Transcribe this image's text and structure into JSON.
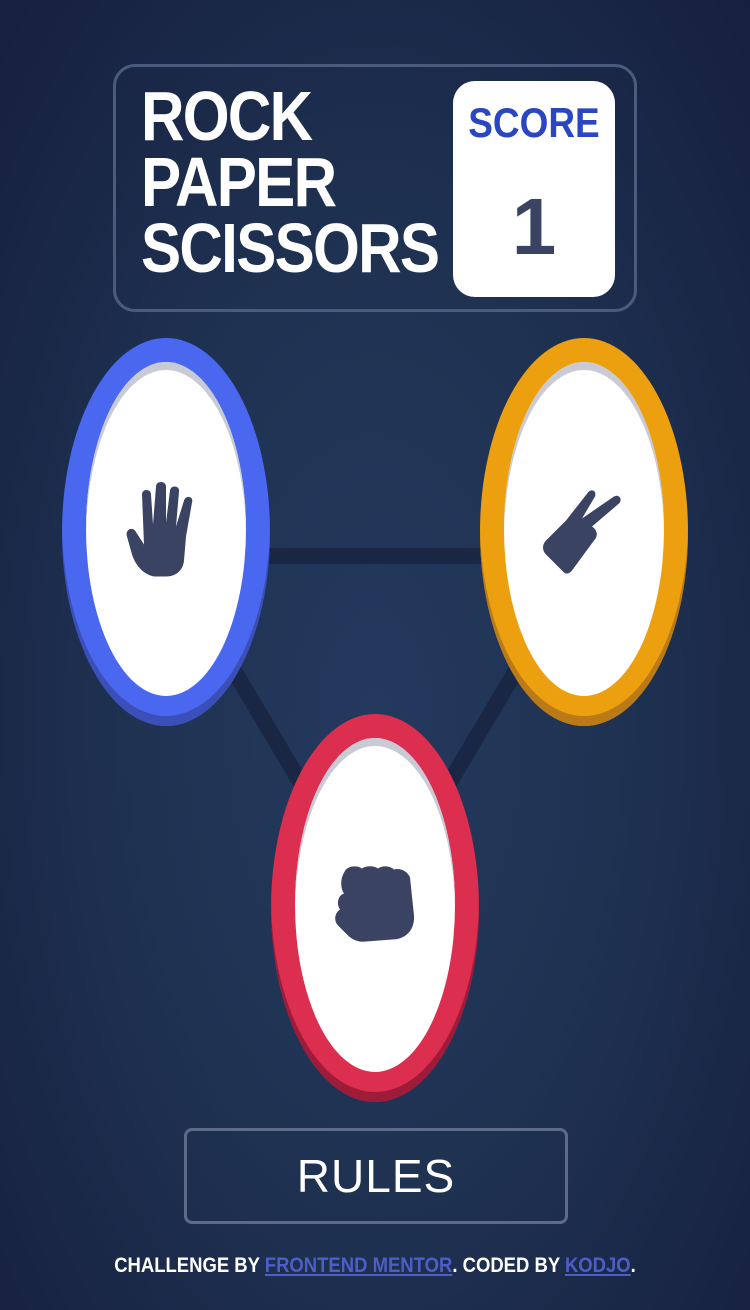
{
  "header": {
    "title_lines": [
      "ROCK",
      "PAPER",
      "SCISSORS"
    ],
    "score_label": "SCORE",
    "score_value": "1"
  },
  "tokens": [
    {
      "name": "paper",
      "color": "#4a67f0",
      "icon": "hand-open-icon"
    },
    {
      "name": "scissors",
      "color": "#eca00f",
      "icon": "hand-peace-icon"
    },
    {
      "name": "rock",
      "color": "#dc2e4e",
      "icon": "hand-fist-icon"
    }
  ],
  "rules_label": "RULES",
  "footer": {
    "prefix": "CHALLENGE BY ",
    "link1": "FRONTEND MENTOR",
    "middle": ". CODED BY ",
    "link2": "KODJO",
    "suffix": "."
  },
  "colors": {
    "background": "#1f3252",
    "score_label": "#2a46c0",
    "score_value": "#3b4363",
    "link": "#4e5ec7"
  }
}
